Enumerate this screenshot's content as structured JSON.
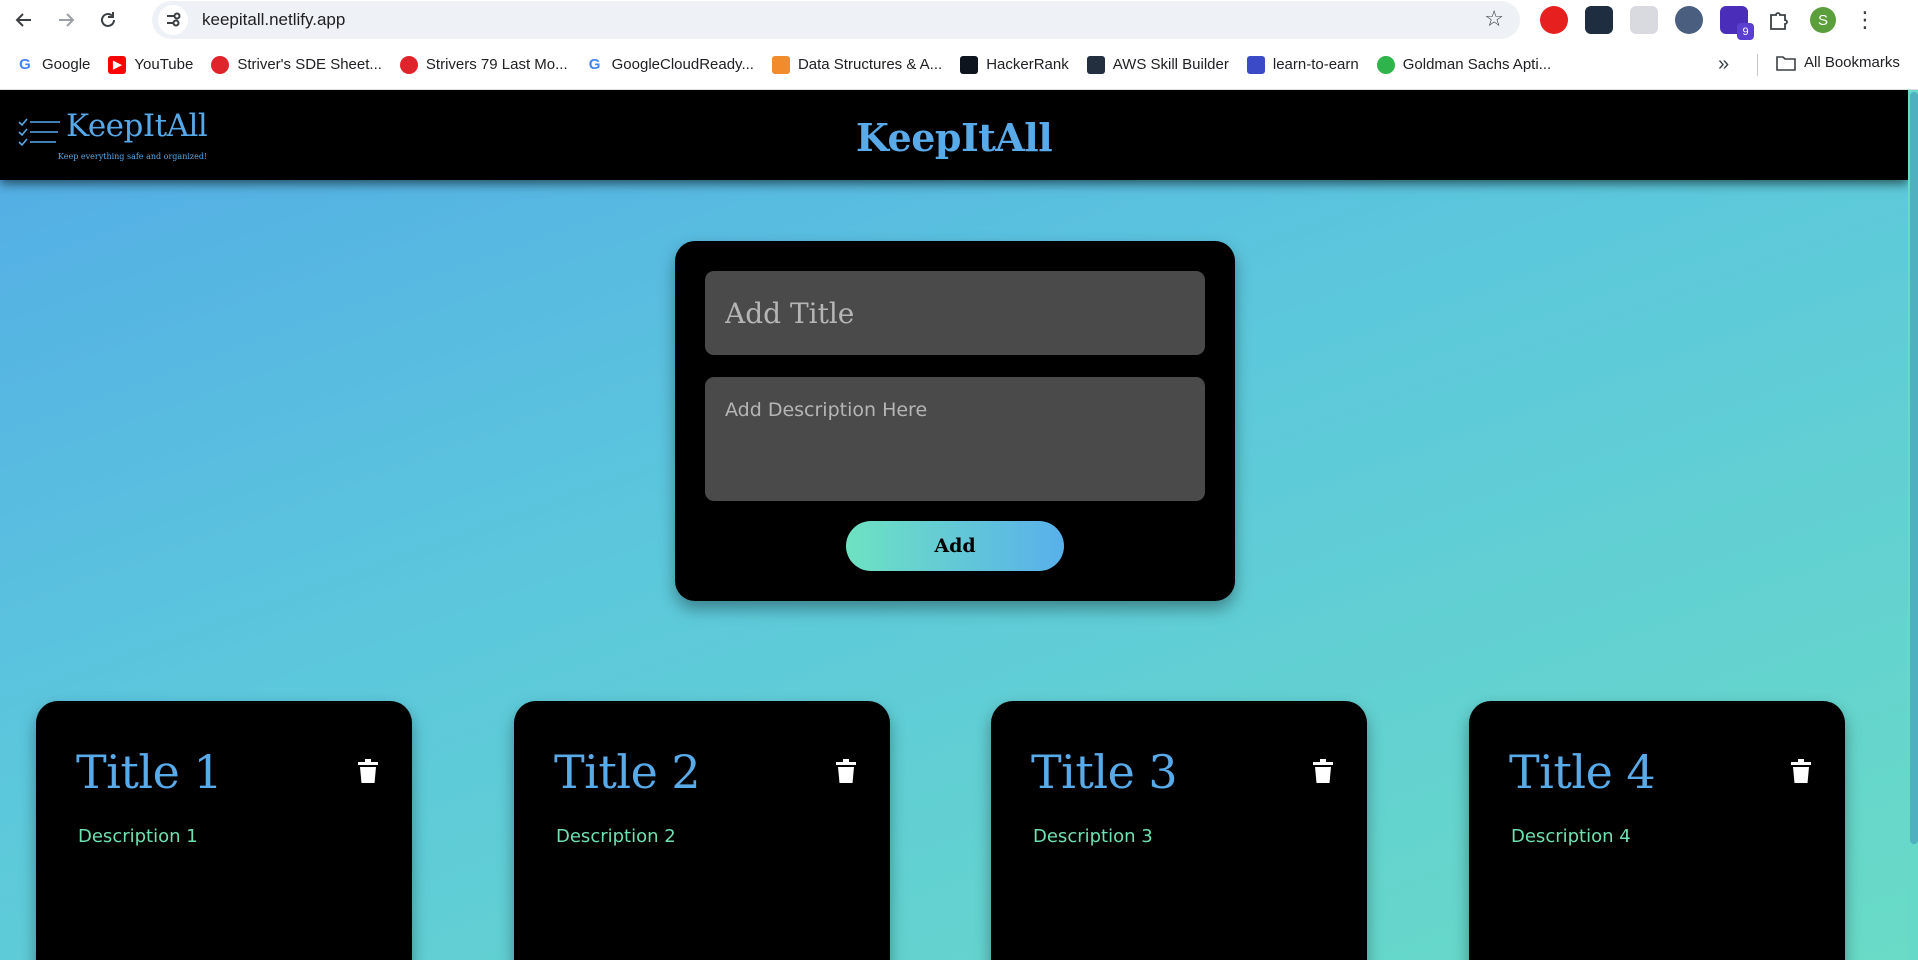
{
  "browser": {
    "url": "keepitall.netlify.app",
    "extensions": [
      {
        "icon": "adblock-extension-icon",
        "color": "#e5201f"
      },
      {
        "icon": "react-devtools-icon",
        "color": "#1f2d40"
      },
      {
        "icon": "triangle-extension-icon",
        "color": "#d8dadf"
      },
      {
        "icon": "cursor-extension-icon",
        "color": "#4a5f80"
      },
      {
        "icon": "hat-extension-icon",
        "color": "#4a2db8",
        "badge": "9"
      },
      {
        "icon": "puzzle-extensions-icon",
        "color": "#3c4043"
      }
    ],
    "profile_initial": "S",
    "bookmarks": [
      {
        "label": "Google",
        "icon": "google-icon",
        "color": "#4285f4"
      },
      {
        "label": "YouTube",
        "icon": "youtube-icon",
        "color": "#ff0000"
      },
      {
        "label": "Striver's SDE Sheet...",
        "icon": "tuf-icon",
        "color": "#e0242b"
      },
      {
        "label": "Strivers 79 Last Mo...",
        "icon": "tuf-icon",
        "color": "#e0242b"
      },
      {
        "label": "GoogleCloudReady...",
        "icon": "google-icon",
        "color": "#4285f4"
      },
      {
        "label": "Data Structures & A...",
        "icon": "geeks-icon",
        "color": "#f18b2b"
      },
      {
        "label": "HackerRank",
        "icon": "hackerrank-icon",
        "color": "#0e141e"
      },
      {
        "label": "AWS Skill Builder",
        "icon": "aws-icon",
        "color": "#232f3e"
      },
      {
        "label": "learn-to-earn",
        "icon": "learn-icon",
        "color": "#3b4bc8"
      },
      {
        "label": "Goldman Sachs Apti...",
        "icon": "hirepro-icon",
        "color": "#2fb34b"
      }
    ],
    "all_bookmarks_label": "All Bookmarks"
  },
  "header": {
    "logo_text": "KeepItAll",
    "logo_tagline": "Keep everything safe and organized!",
    "title": "KeepItAll"
  },
  "form": {
    "title_placeholder": "Add Title",
    "description_placeholder": "Add Description Here",
    "add_label": "Add"
  },
  "notes": [
    {
      "title": "Title 1",
      "description": "Description 1"
    },
    {
      "title": "Title 2",
      "description": "Description 2"
    },
    {
      "title": "Title 3",
      "description": "Description 3"
    },
    {
      "title": "Title 4",
      "description": "Description 4"
    }
  ],
  "colors": {
    "accent_blue": "#58aae9",
    "accent_green": "#6fe0b0",
    "card_bg": "#000000",
    "input_bg": "#4a4a4a"
  }
}
